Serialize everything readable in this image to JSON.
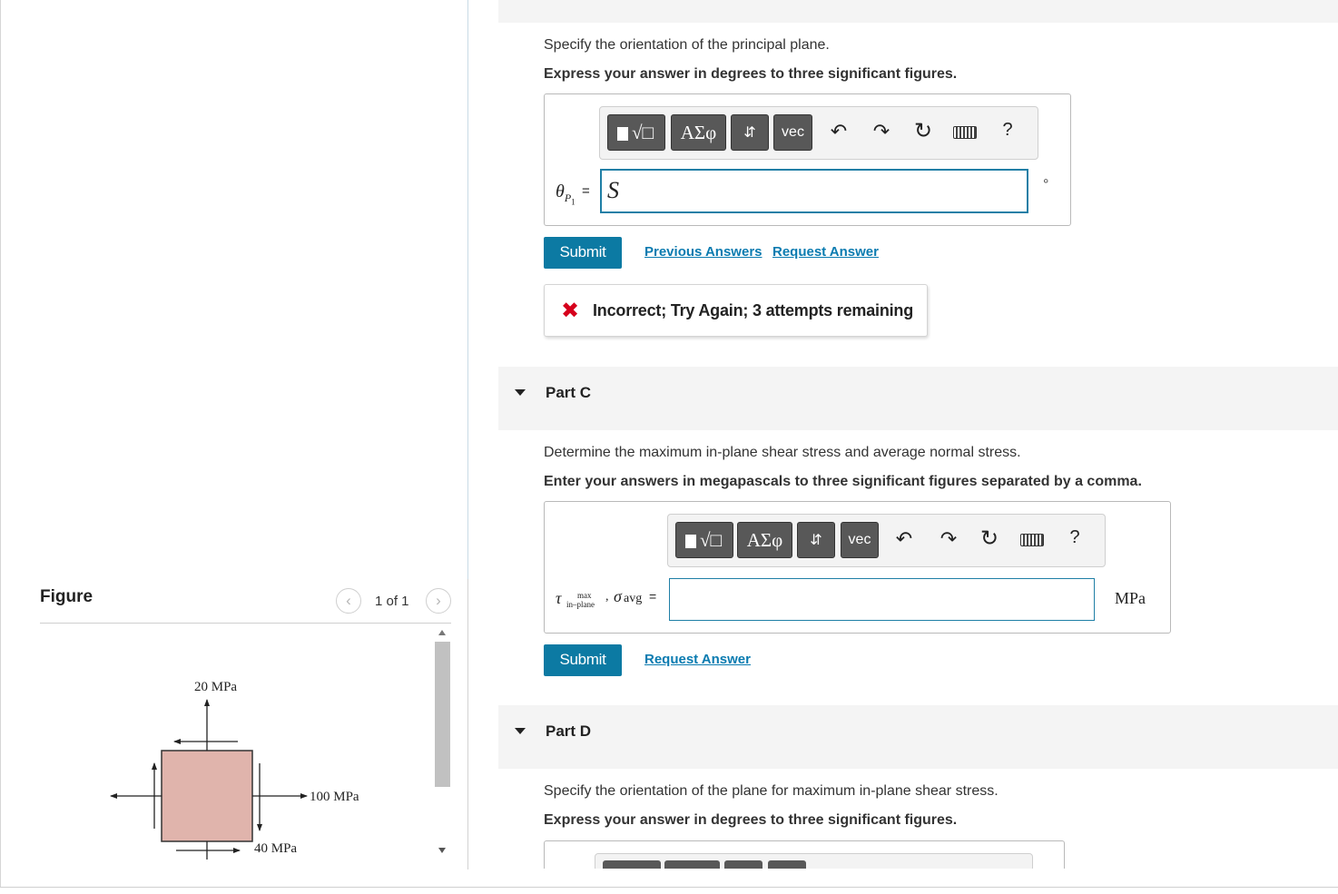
{
  "figure": {
    "title": "Figure",
    "counter": "1 of 1",
    "prev_icon": "chevron-left-icon",
    "next_icon": "chevron-right-icon",
    "labels": {
      "top": "20 MPa",
      "right": "100 MPa",
      "bottom": "40 MPa"
    },
    "colors": {
      "element_fill": "#e0b4ac"
    }
  },
  "part_b": {
    "prompt": "Specify the orientation of the principal plane.",
    "instruction": "Express your answer in degrees to three significant figures.",
    "toolbar": {
      "buttons": [
        "√□",
        "ΑΣφ",
        "⇵",
        "vec"
      ],
      "icons": [
        "undo-icon",
        "redo-icon",
        "reset-icon",
        "keyboard-icon",
        "help-icon"
      ],
      "help": "?"
    },
    "input_label_theta": "θ",
    "input_label_sub": "P",
    "input_label_subsub": "1",
    "equals": "=",
    "input_value": "S",
    "unit": "°",
    "submit": "Submit",
    "previous_answers": "Previous Answers",
    "request_answer": "Request Answer",
    "feedback": "Incorrect; Try Again; 3 attempts remaining"
  },
  "part_c": {
    "title": "Part C",
    "prompt": "Determine the maximum in-plane shear stress and average normal stress.",
    "instruction": "Enter your answers in megapascals to three significant figures separated by a comma.",
    "toolbar": {
      "buttons": [
        "√□",
        "ΑΣφ",
        "⇵",
        "vec"
      ],
      "help": "?"
    },
    "tau": "τ",
    "tau_sup": "max",
    "tau_sub": "in–plane",
    "comma": ",",
    "sigma": "σ",
    "sigma_sub": "avg",
    "equals": "=",
    "input_value": "",
    "unit": "MPa",
    "submit": "Submit",
    "request_answer": "Request Answer"
  },
  "part_d": {
    "title": "Part D",
    "prompt": "Specify the orientation of the plane for maximum in-plane shear stress.",
    "instruction": "Express your answer in degrees to three significant figures."
  }
}
